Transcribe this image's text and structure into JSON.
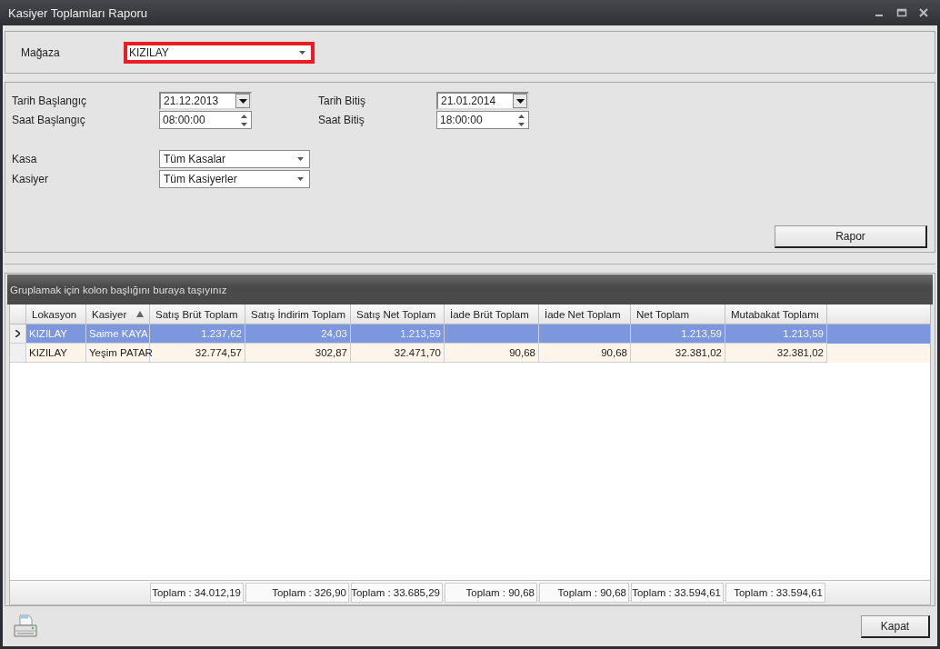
{
  "window": {
    "title": "Kasiyer Toplamları Raporu"
  },
  "store": {
    "label": "Mağaza",
    "value": "KIZILAY",
    "highlighted": true
  },
  "date_range": [
    {
      "kind": "date",
      "label": "Tarih Başlangıç",
      "value": "21.12.2013"
    },
    {
      "kind": "date",
      "label": "Tarih Bitiş",
      "value": "21.01.2014"
    },
    {
      "kind": "time",
      "label": "Saat Başlangıç",
      "value": "08:00:00"
    },
    {
      "kind": "time",
      "label": "Saat Bitiş",
      "value": "18:00:00"
    }
  ],
  "filters": [
    {
      "label": "Kasa",
      "value": "Tüm Kasalar"
    },
    {
      "label": "Kasiyer",
      "value": "Tüm Kasiyerler"
    }
  ],
  "report_button": "Rapor",
  "grid": {
    "group_hint": "Gruplamak için kolon başlığını buraya taşıyınız",
    "columns": [
      {
        "label": "Lokasyon",
        "sorted": false
      },
      {
        "label": "Kasiyer",
        "sorted": true
      },
      {
        "label": "Satış Brüt Toplam",
        "sorted": false
      },
      {
        "label": "Satış İndirim Toplam",
        "sorted": false
      },
      {
        "label": "Satış Net Toplam",
        "sorted": false
      },
      {
        "label": "İade Brüt Toplam",
        "sorted": false
      },
      {
        "label": "İade Net Toplam",
        "sorted": false
      },
      {
        "label": "Net Toplam",
        "sorted": false
      },
      {
        "label": "Mutabakat Toplamı",
        "sorted": false
      }
    ],
    "rows": [
      {
        "selected": true,
        "cells": [
          "KIZILAY",
          "Saime KAYA",
          "1.237,62",
          "24,03",
          "1.213,59",
          null,
          null,
          "1.213,59",
          "1.213,59"
        ]
      },
      {
        "selected": false,
        "cells": [
          "KIZILAY",
          "Yeşim PATAR",
          "32.774,57",
          "302,87",
          "32.471,70",
          "90,68",
          "90,68",
          "32.381,02",
          "32.381,02"
        ]
      }
    ],
    "totals": [
      "Toplam : 34.012,19",
      "Toplam : 326,90",
      "Toplam : 33.685,29",
      "Toplam : 90,68",
      "Toplam : 90,68",
      "Toplam : 33.594,61",
      "Toplam : 33.594,61"
    ]
  },
  "close_button": "Kapat"
}
